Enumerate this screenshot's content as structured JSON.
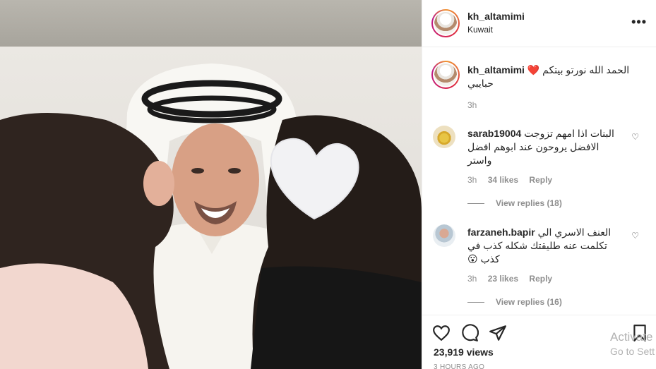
{
  "post": {
    "username": "kh_altamimi",
    "location": "Kuwait",
    "more_label": "•••",
    "caption": "الحمد الله نورتو بيتكم ❤️ حبايبي",
    "caption_time": "3h"
  },
  "comments": [
    {
      "username": "sarab19004",
      "text": "البنات اذا امهم تزوجت الافضل يروحون عند ابوهم افضل واستر",
      "time": "3h",
      "likes": "34 likes",
      "reply": "Reply",
      "view_replies": "View replies (18)"
    },
    {
      "username": "farzaneh.bapir",
      "text": "العنف الاسري الي تكلمت عنه طليقتك شكله كذب في كذب 😮",
      "time": "3h",
      "likes": "23 likes",
      "reply": "Reply",
      "view_replies": "View replies (16)"
    }
  ],
  "actions": {
    "views": "23,919 views",
    "time_ago": "3 HOURS AGO"
  },
  "os_overlay": {
    "line1": "Activate",
    "line2": "Go to Sett"
  },
  "icons": {
    "like": "heart-outline-icon",
    "comment": "comment-bubble-icon",
    "share": "paper-plane-icon",
    "save": "bookmark-icon",
    "more": "more-dots-icon",
    "comment_like": "heart-outline-icon"
  },
  "colors": {
    "text": "#262626",
    "secondary": "#8e8e8e",
    "border": "#efefef",
    "accent_heart": "#e0245e"
  }
}
